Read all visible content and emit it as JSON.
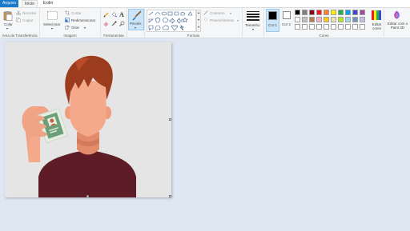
{
  "tabs": {
    "file": "Arquivo",
    "home": "Início",
    "view": "Exibir"
  },
  "clipboard": {
    "paste": "Colar",
    "cut": "Recortar",
    "copy": "Copiar",
    "label": "Área de Transferência"
  },
  "image": {
    "select": "Selecionar",
    "crop": "Cortar",
    "resize": "Redimensionar",
    "rotate": "Girar",
    "label": "Imagem"
  },
  "tools": {
    "label": "Ferramentas"
  },
  "brushes": {
    "label": "Pincéis"
  },
  "shapes": {
    "outline": "Contorno",
    "fill": "Preenchimento",
    "label": "Formas"
  },
  "size": {
    "label": "Tamanho"
  },
  "colors": {
    "color1": "Cor 1",
    "color1_value": "#000000",
    "color2": "Cor 2",
    "color2_value": "#ffffff",
    "edit": "Editar cores",
    "label": "Cores",
    "row1": [
      "#000000",
      "#7f7f7f",
      "#880015",
      "#ed1c24",
      "#ff7f27",
      "#fff200",
      "#22b14c",
      "#00a2e8",
      "#3f48cc",
      "#a349a4"
    ],
    "row2": [
      "#ffffff",
      "#c3c3c3",
      "#b97a57",
      "#ffaec9",
      "#ffc90e",
      "#efe4b0",
      "#b5e61d",
      "#99d9ea",
      "#7092be",
      "#c8bfe7"
    ]
  },
  "paint3d": {
    "label": "Editar com o Paint 3D"
  }
}
